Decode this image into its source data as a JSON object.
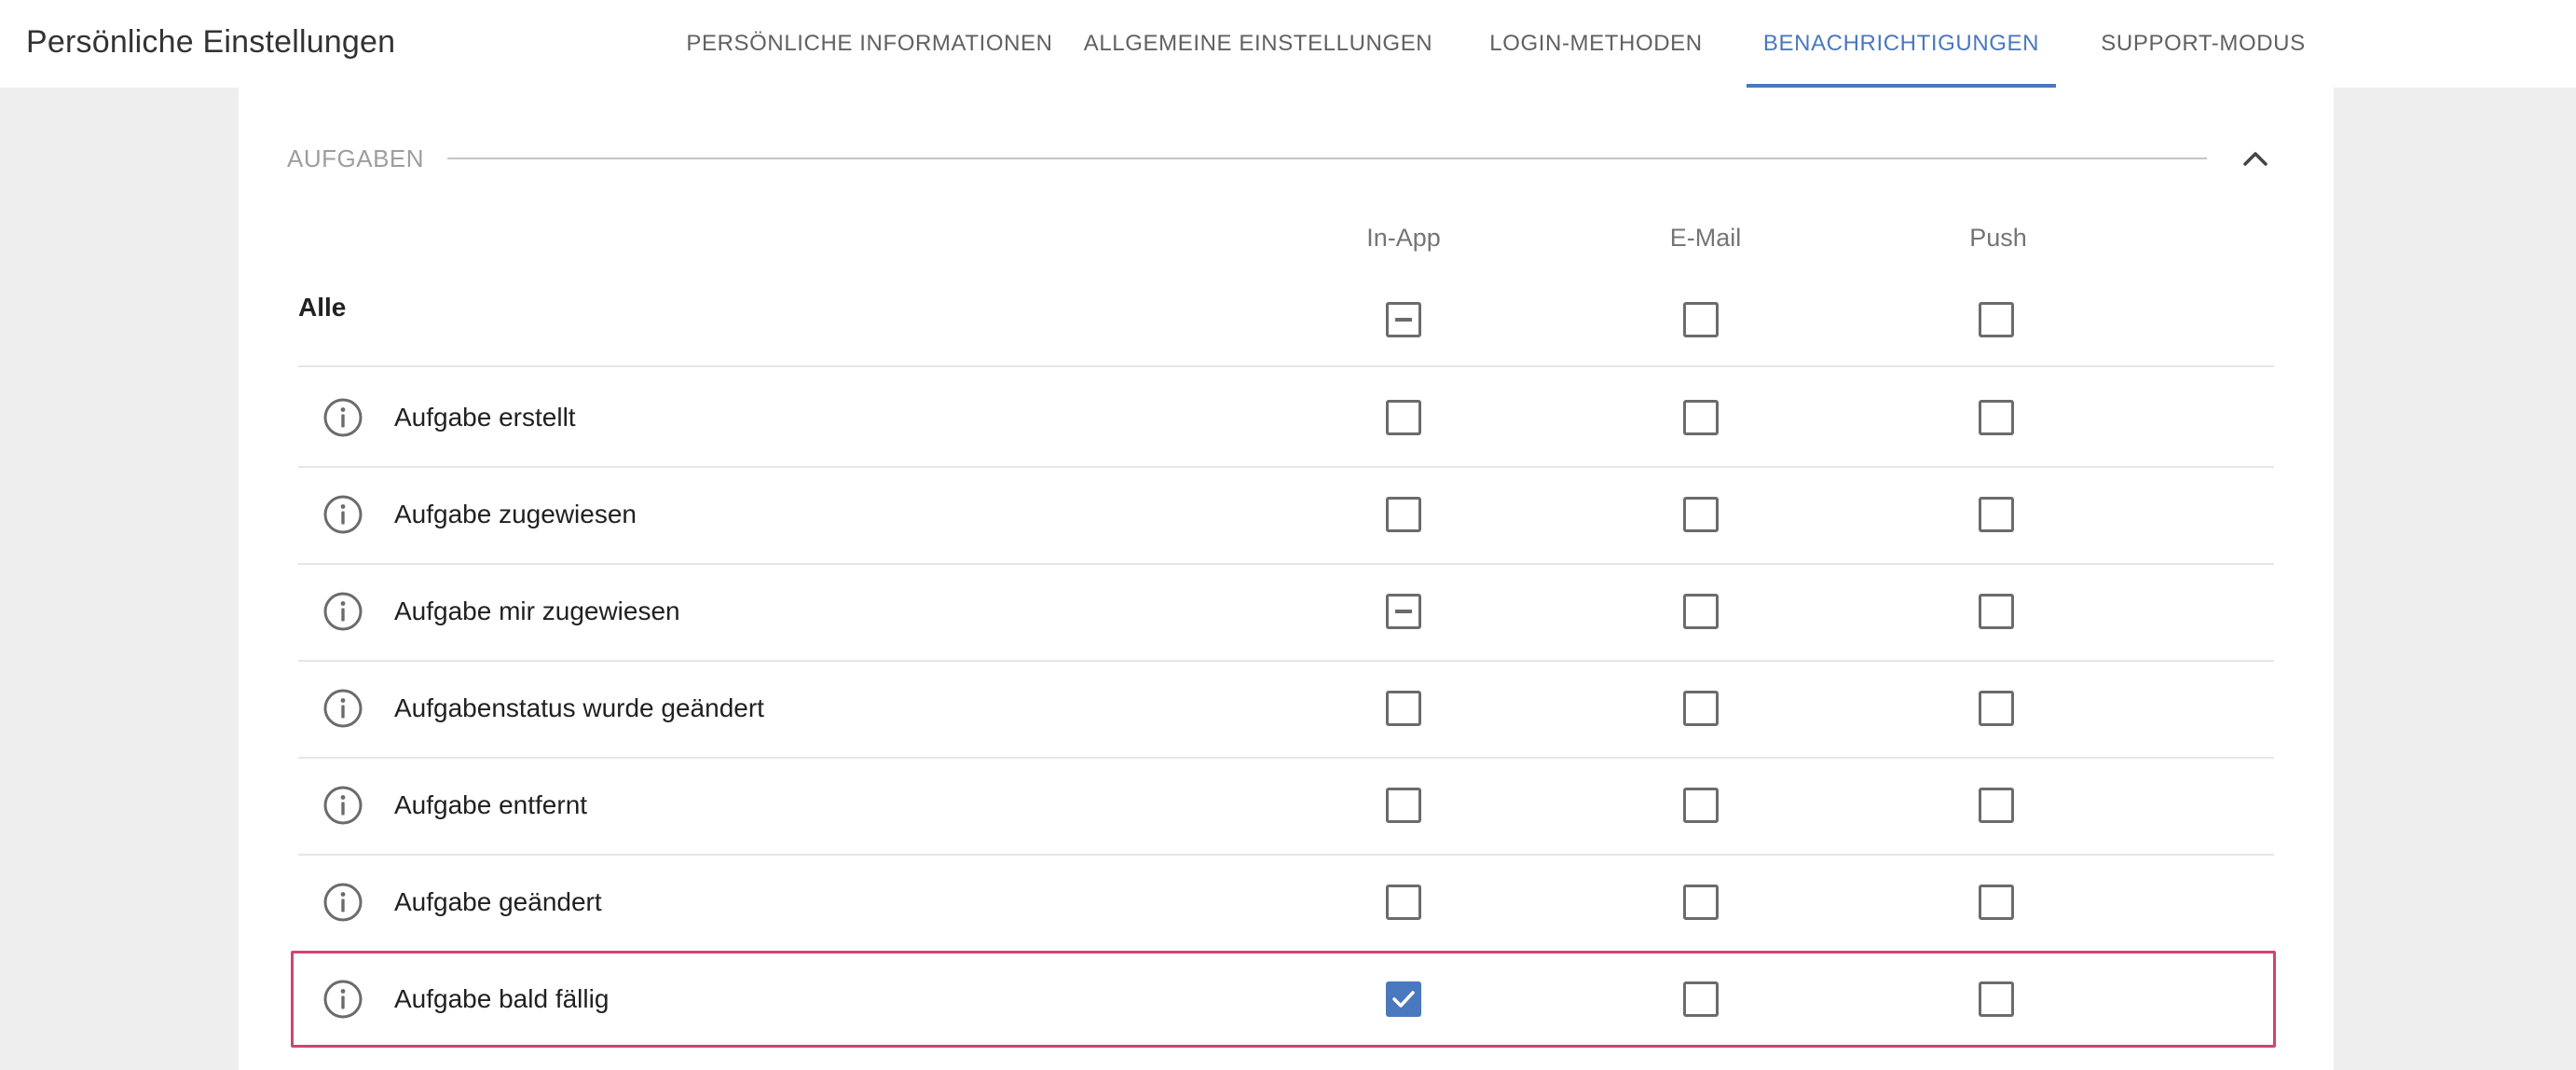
{
  "header": {
    "title": "Persönliche Einstellungen",
    "tabs": [
      {
        "label": "Persönliche Informationen",
        "active": false
      },
      {
        "label": "Allgemeine Einstellungen",
        "active": false
      },
      {
        "label": "Login-Methoden",
        "active": false
      },
      {
        "label": "Benachrichtigungen",
        "active": true
      },
      {
        "label": "Support-Modus",
        "active": false
      }
    ]
  },
  "section": {
    "title": "AUFGABEN",
    "collapse_icon": "chevron-up-icon"
  },
  "columns": [
    "In-App",
    "E-Mail",
    "Push"
  ],
  "all_row": {
    "label": "Alle",
    "states": [
      "indeterminate",
      "unchecked",
      "unchecked"
    ]
  },
  "rows": [
    {
      "label": "Aufgabe erstellt",
      "icon": "info-icon",
      "states": [
        "unchecked",
        "unchecked",
        "unchecked"
      ]
    },
    {
      "label": "Aufgabe zugewiesen",
      "icon": "info-icon",
      "states": [
        "unchecked",
        "unchecked",
        "unchecked"
      ]
    },
    {
      "label": "Aufgabe mir zugewiesen",
      "icon": "info-icon",
      "states": [
        "indeterminate",
        "unchecked",
        "unchecked"
      ]
    },
    {
      "label": "Aufgabenstatus wurde geändert",
      "icon": "info-icon",
      "states": [
        "unchecked",
        "unchecked",
        "unchecked"
      ]
    },
    {
      "label": "Aufgabe entfernt",
      "icon": "info-icon",
      "states": [
        "unchecked",
        "unchecked",
        "unchecked"
      ]
    },
    {
      "label": "Aufgabe geändert",
      "icon": "info-icon",
      "states": [
        "unchecked",
        "unchecked",
        "unchecked"
      ]
    },
    {
      "label": "Aufgabe bald fällig",
      "icon": "info-icon",
      "states": [
        "checked",
        "unchecked",
        "unchecked"
      ],
      "highlighted": true
    }
  ],
  "colors": {
    "accent": "#4a78be",
    "highlight": "#d1446f",
    "background": "#eeeeee"
  }
}
